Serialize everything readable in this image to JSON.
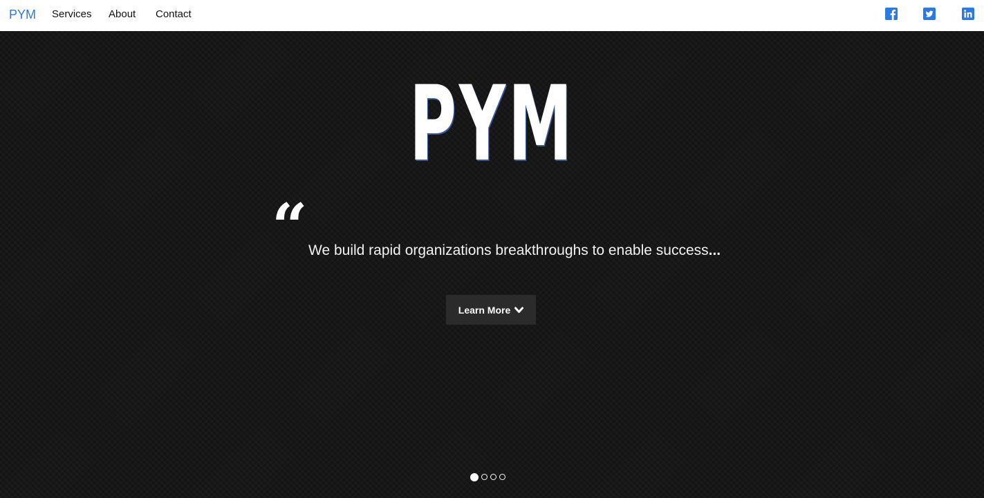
{
  "nav": {
    "brand": "PYM",
    "links": [
      "Services",
      "About",
      "Contact"
    ],
    "social_icons": [
      "facebook-icon",
      "twitter-icon",
      "linkedin-icon"
    ],
    "accent_color": "#2a7ae2"
  },
  "hero": {
    "title": "PYM",
    "quote_mark": "“",
    "tagline": "We build rapid organizations breakthroughs to enable success",
    "tagline_suffix": "...",
    "button_label": "Learn More",
    "button_icon": "chevron-down-icon",
    "carousel_count": 4,
    "carousel_active": 1
  }
}
